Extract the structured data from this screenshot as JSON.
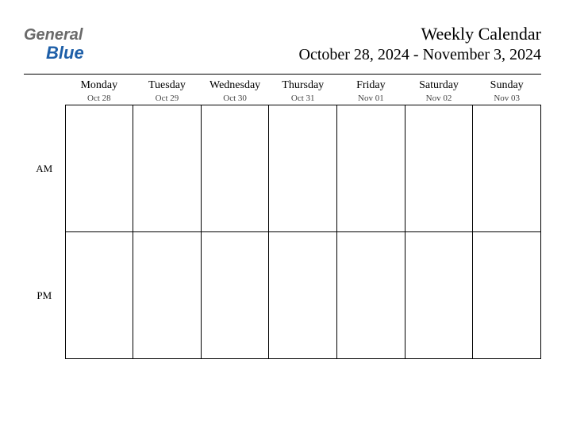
{
  "logo": {
    "line1": "General",
    "line2": "Blue"
  },
  "title": "Weekly Calendar",
  "date_range": "October 28, 2024 - November 3, 2024",
  "rows": [
    {
      "label": "AM"
    },
    {
      "label": "PM"
    }
  ],
  "days": [
    {
      "name": "Monday",
      "date": "Oct 28"
    },
    {
      "name": "Tuesday",
      "date": "Oct 29"
    },
    {
      "name": "Wednesday",
      "date": "Oct 30"
    },
    {
      "name": "Thursday",
      "date": "Oct 31"
    },
    {
      "name": "Friday",
      "date": "Nov 01"
    },
    {
      "name": "Saturday",
      "date": "Nov 02"
    },
    {
      "name": "Sunday",
      "date": "Nov 03"
    }
  ]
}
